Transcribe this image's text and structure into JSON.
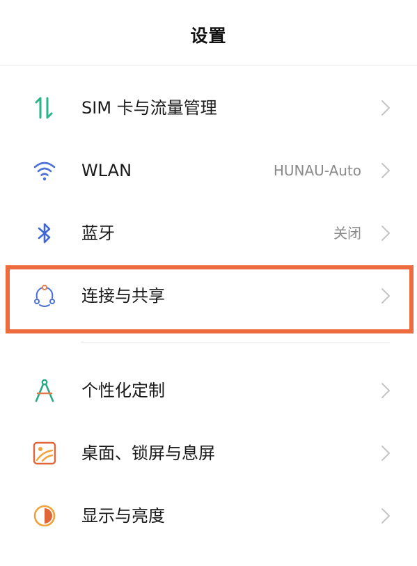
{
  "header": {
    "title": "设置"
  },
  "items": [
    {
      "label": "SIM 卡与流量管理",
      "value": "",
      "icon": "sim-data-icon"
    },
    {
      "label": "WLAN",
      "value": "HUNAU-Auto",
      "icon": "wifi-icon"
    },
    {
      "label": "蓝牙",
      "value": "关闭",
      "icon": "bluetooth-icon"
    },
    {
      "label": "连接与共享",
      "value": "",
      "icon": "connection-share-icon"
    },
    {
      "label": "个性化定制",
      "value": "",
      "icon": "personalization-icon"
    },
    {
      "label": "桌面、锁屏与息屏",
      "value": "",
      "icon": "wallpaper-icon"
    },
    {
      "label": "显示与亮度",
      "value": "",
      "icon": "display-brightness-icon"
    }
  ],
  "colors": {
    "highlight": "#ee6b3e",
    "sim_icon": "#2bb38a",
    "wifi_icon": "#4a6fd6",
    "bluetooth_icon": "#3f67d8",
    "personalization_icon": "#27a984",
    "wallpaper_icon": "#e0663a",
    "display_icon": "#f2a23a"
  }
}
